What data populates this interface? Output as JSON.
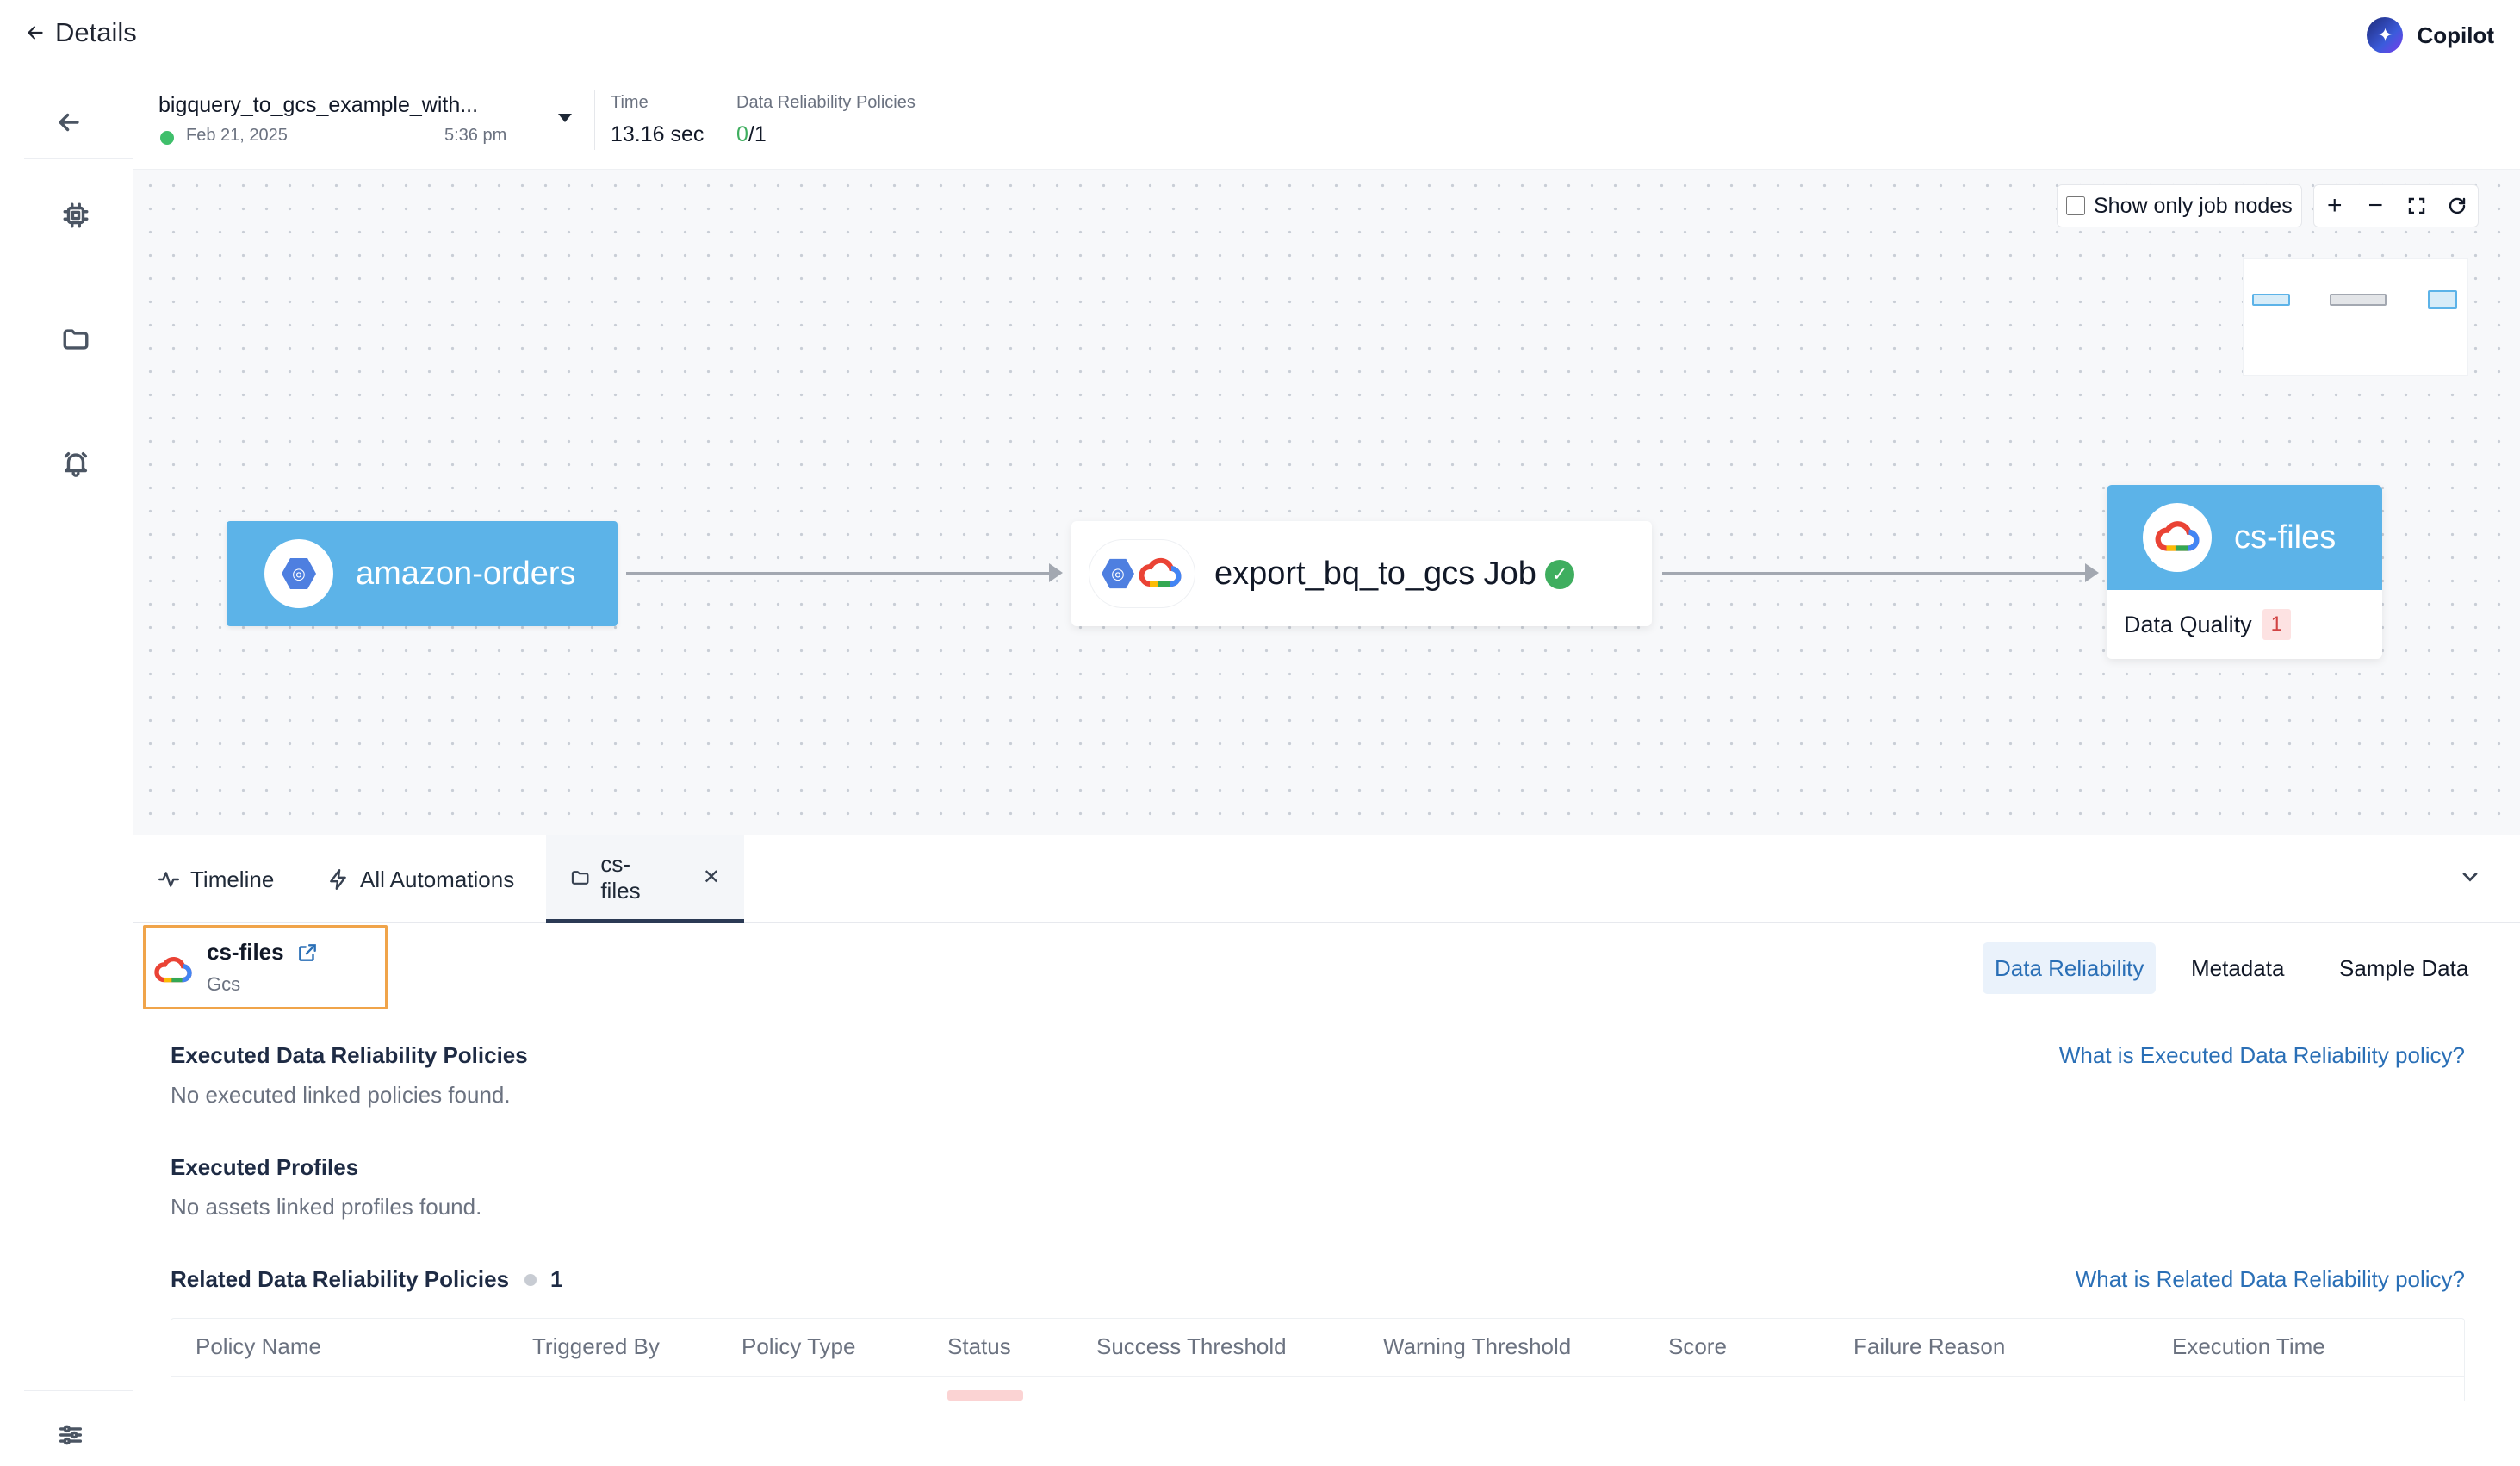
{
  "header": {
    "back_label": "Details",
    "copilot_label": "Copilot"
  },
  "run": {
    "name": "bigquery_to_gcs_example_with...",
    "date": "Feb 21, 2025",
    "time_of_day": "5:36 pm",
    "time_label": "Time",
    "time_value": "13.16 sec",
    "policies_label": "Data Reliability Policies",
    "policies_passed": "0",
    "policies_total": "/1"
  },
  "canvas": {
    "show_only_job_nodes_label": "Show only job nodes",
    "show_only_job_nodes_checked": false,
    "nodes": {
      "source": "amazon-orders",
      "job": "export_bq_to_gcs Job",
      "target": "cs-files",
      "target_dq_label": "Data Quality",
      "target_dq_count": "1"
    },
    "colors": {
      "node_blue": "#5cb3e8",
      "success_green": "#3fae5f",
      "alert_red": "#d14343"
    }
  },
  "tabs": [
    {
      "label": "Timeline",
      "icon": "activity-icon"
    },
    {
      "label": "All Automations",
      "icon": "bolt-icon"
    },
    {
      "label": "cs-files",
      "icon": "folder-icon",
      "active": true,
      "closable": true
    }
  ],
  "asset": {
    "name": "cs-files",
    "type": "Gcs",
    "subtabs": [
      "Data Reliability",
      "Metadata",
      "Sample Data"
    ],
    "active_subtab": "Data Reliability"
  },
  "sections": {
    "executed_policies_title": "Executed Data Reliability Policies",
    "executed_policies_empty": "No executed linked policies found.",
    "executed_policies_help": "What is Executed Data Reliability policy?",
    "executed_profiles_title": "Executed Profiles",
    "executed_profiles_empty": "No assets linked profiles found.",
    "related_policies_title": "Related Data Reliability Policies",
    "related_policies_count": "1",
    "related_policies_help": "What is Related Data Reliability policy?"
  },
  "table": {
    "columns": [
      "Policy Name",
      "Triggered By",
      "Policy Type",
      "Status",
      "Success Threshold",
      "Warning Threshold",
      "Score",
      "Failure Reason",
      "Execution Time"
    ]
  }
}
